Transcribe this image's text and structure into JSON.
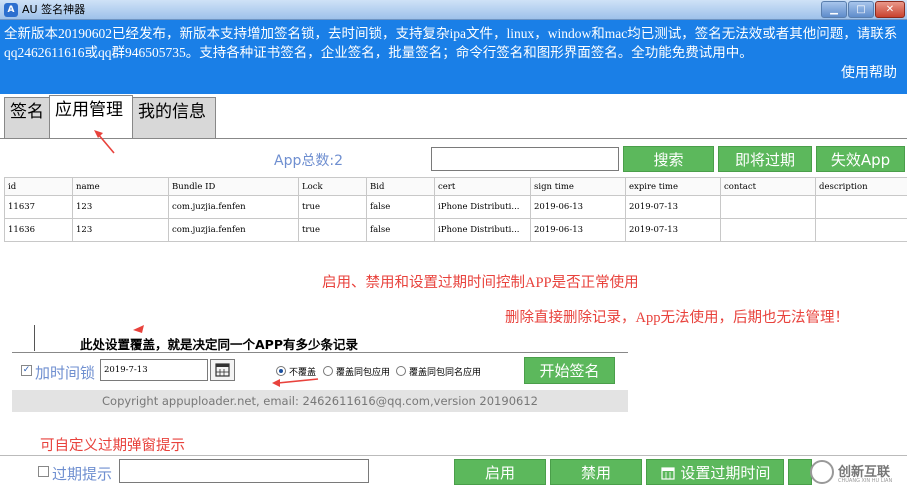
{
  "window": {
    "icon": "au-app-icon",
    "title": "AU 签名神器",
    "min_glyph": "▁",
    "max_glyph": "□",
    "close_glyph": "✕"
  },
  "banner": {
    "notice": "全新版本20190602已经发布，新版本支持增加签名锁，去时间锁，支持复杂ipa文件，linux，window和mac均已测试，签名无法效或者其他问题，请联系qq2462611616或qq群946505735。支持各种证书签名，企业签名，批量签名；命令行签名和图形界面签名。全功能免费试用中。",
    "help_label": "使用帮助",
    "color": "#1a7fe7"
  },
  "tabs": [
    {
      "label": "签名"
    },
    {
      "label": "应用管理"
    },
    {
      "label": "我的信息"
    }
  ],
  "search": {
    "count_label": "App总数:2",
    "value": "",
    "search_label": "搜索",
    "expiring_label": "即将过期",
    "invalid_label": "失效App"
  },
  "table": {
    "columns": [
      "id",
      "name",
      "Bundle ID",
      "Lock",
      "Bid",
      "cert",
      "sign time",
      "expire time",
      "contact",
      "description"
    ],
    "rows": [
      [
        "11637",
        "123",
        "com.juzjia.fenfen",
        "true",
        "false",
        "iPhone Distributi...",
        "2019-06-13",
        "2019-07-13",
        "",
        ""
      ],
      [
        "11636",
        "123",
        "com.juzjia.fenfen",
        "true",
        "false",
        "iPhone Distributi...",
        "2019-06-13",
        "2019-07-13",
        "",
        ""
      ]
    ]
  },
  "annotations": {
    "enable_note": "启用、禁用和设置过期时间控制APP是否正常使用",
    "delete_note": "删除直接删除记录，App无法使用，后期也无法管理！",
    "overwrite_note": "此处设置覆盖，就是决定同一个APP有多少条记录",
    "popup_note": "可自定义过期弹窗提示",
    "color": "#e8423c"
  },
  "options": {
    "lock_checked_glyph": "✓",
    "lock_label": "加时间锁",
    "date_value": "2019-7-13",
    "calendar_icon": "calendar-icon",
    "radio_1": "不覆盖",
    "radio_2": "覆盖同包应用",
    "radio_3": "覆盖同包同名应用",
    "start_sign_label": "开始签名",
    "copyright": "Copyright appuploader.net, email: 2462611616@qq.com,version 20190612"
  },
  "bottom": {
    "expire_prompt_label": "过期提示",
    "expire_prompt_value": "",
    "enable_label": "启用",
    "disable_label": "禁用",
    "set_expire_label": "设置过期时间",
    "accent": "#5cb85c"
  },
  "watermark": {
    "text": "创新互联",
    "sub": "CHUANG XIN HU LIAN"
  }
}
